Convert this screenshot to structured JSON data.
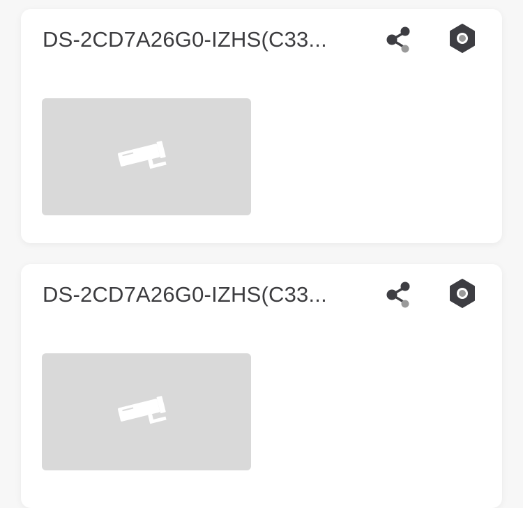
{
  "cameras": [
    {
      "title": "DS-2CD7A26G0-IZHS(C33...",
      "share_icon": "share-icon",
      "settings_icon": "settings-hexagon-icon",
      "thumbnail_icon": "camera-placeholder-icon"
    },
    {
      "title": "DS-2CD7A26G0-IZHS(C33...",
      "share_icon": "share-icon",
      "settings_icon": "settings-hexagon-icon",
      "thumbnail_icon": "camera-placeholder-icon"
    }
  ],
  "colors": {
    "background": "#f7f7f7",
    "card": "#ffffff",
    "title_text": "#3c3c3f",
    "icon_dark": "#3d3d42",
    "icon_light": "#9a9a9a",
    "thumbnail_bg": "#d9d9d9",
    "thumbnail_icon": "#ffffff"
  }
}
